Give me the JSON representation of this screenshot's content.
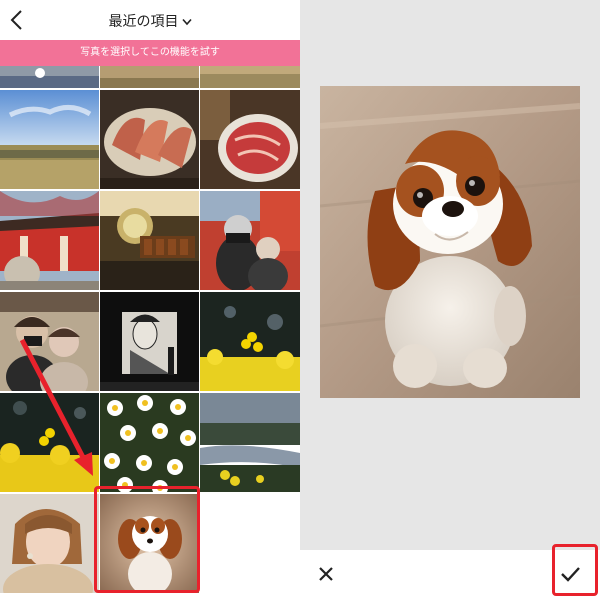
{
  "header": {
    "album_title": "最近の項目"
  },
  "banner": {
    "text": "写真を選択してこの機能を試す"
  },
  "icons": {
    "back": "chevron-left-icon",
    "album_dropdown": "chevron-down-icon",
    "close": "close-icon",
    "confirm": "checkmark-icon"
  },
  "colors": {
    "banner": "#f27297",
    "highlight": "#e8222c",
    "panel_bg": "#e6e6e6"
  }
}
